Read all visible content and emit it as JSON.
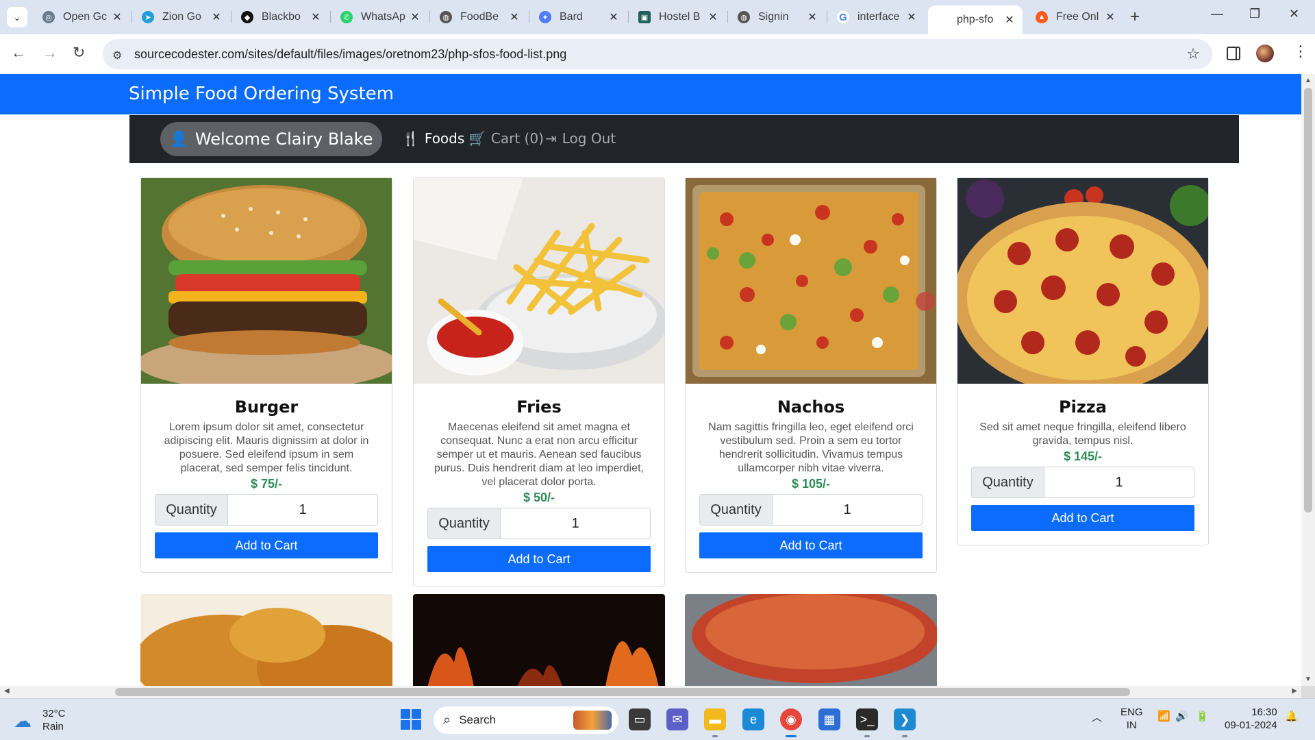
{
  "browser": {
    "tabs": [
      {
        "title": "Open Gc",
        "fav_color": "#6b7b8c",
        "fav_glyph": "◎",
        "icon": "openai-icon"
      },
      {
        "title": "Zion Go",
        "fav_color": "#229ED9",
        "fav_glyph": "➤",
        "icon": "telegram-icon"
      },
      {
        "title": "Blackbo",
        "fav_color": "#111111",
        "fav_glyph": "◆",
        "icon": "blackbox-icon"
      },
      {
        "title": "WhatsAp",
        "fav_color": "#25D366",
        "fav_glyph": "✆",
        "icon": "whatsapp-icon"
      },
      {
        "title": "FoodBe",
        "fav_color": "#555555",
        "fav_glyph": "◍",
        "icon": "globe-icon"
      },
      {
        "title": "Bard",
        "fav_color": "#4f7df3",
        "fav_glyph": "✦",
        "icon": "bard-icon"
      },
      {
        "title": "Hostel B",
        "fav_color": "#1f5f5b",
        "fav_glyph": "▣",
        "icon": "hostel-icon"
      },
      {
        "title": "Signin",
        "fav_color": "#555555",
        "fav_glyph": "◍",
        "icon": "globe-icon"
      },
      {
        "title": "interface",
        "fav_color": "#4285F4",
        "fav_glyph": "G",
        "icon": "google-icon"
      },
      {
        "title": "php-sfo",
        "fav_color": "#ffffff",
        "fav_glyph": "",
        "icon": "blank-page-icon"
      },
      {
        "title": "Free Onl",
        "fav_color": "#ff5a1f",
        "fav_glyph": "▲",
        "icon": "fire-icon"
      }
    ],
    "url": "sourcecodester.com/sites/default/files/images/oretnom23/php-sfos-food-list.png"
  },
  "site": {
    "brand": "Simple Food Ordering System",
    "welcome": "Welcome Clairy Blake",
    "nav": {
      "foods": "Foods",
      "cart": "Cart (0)",
      "logout": "Log Out"
    }
  },
  "foods": [
    {
      "name": "Burger",
      "desc": "Lorem ipsum dolor sit amet, consectetur adipiscing elit. Mauris dignissim at dolor in posuere. Sed eleifend ipsum in sem placerat, sed semper felis tincidunt.",
      "price": "$ 75/-",
      "qty_label": "Quantity",
      "qty": "1",
      "btn": "Add to Cart"
    },
    {
      "name": "Fries",
      "desc": "Maecenas eleifend sit amet magna et consequat. Nunc a erat non arcu efficitur semper ut et mauris. Aenean sed faucibus purus. Duis hendrerit diam at leo imperdiet, vel placerat dolor porta.",
      "price": "$ 50/-",
      "qty_label": "Quantity",
      "qty": "1",
      "btn": "Add to Cart"
    },
    {
      "name": "Nachos",
      "desc": "Nam sagittis fringilla leo, eget eleifend orci vestibulum sed. Proin a sem eu tortor hendrerit sollicitudin. Vivamus tempus ullamcorper nibh vitae viverra.",
      "price": "$ 105/-",
      "qty_label": "Quantity",
      "qty": "1",
      "btn": "Add to Cart"
    },
    {
      "name": "Pizza",
      "desc": "Sed sit amet neque fringilla, eleifend libero gravida, tempus nisl.",
      "price": "$ 145/-",
      "qty_label": "Quantity",
      "qty": "1",
      "btn": "Add to Cart"
    }
  ],
  "taskbar": {
    "weather_temp": "32°C",
    "weather_desc": "Rain",
    "search": "Search",
    "lang1": "ENG",
    "lang2": "IN",
    "time": "16:30",
    "date": "09-01-2024"
  },
  "colors": {
    "brand_blue": "#0b6cff",
    "navbar_dark": "#212529",
    "price_green": "#2e8b57"
  }
}
